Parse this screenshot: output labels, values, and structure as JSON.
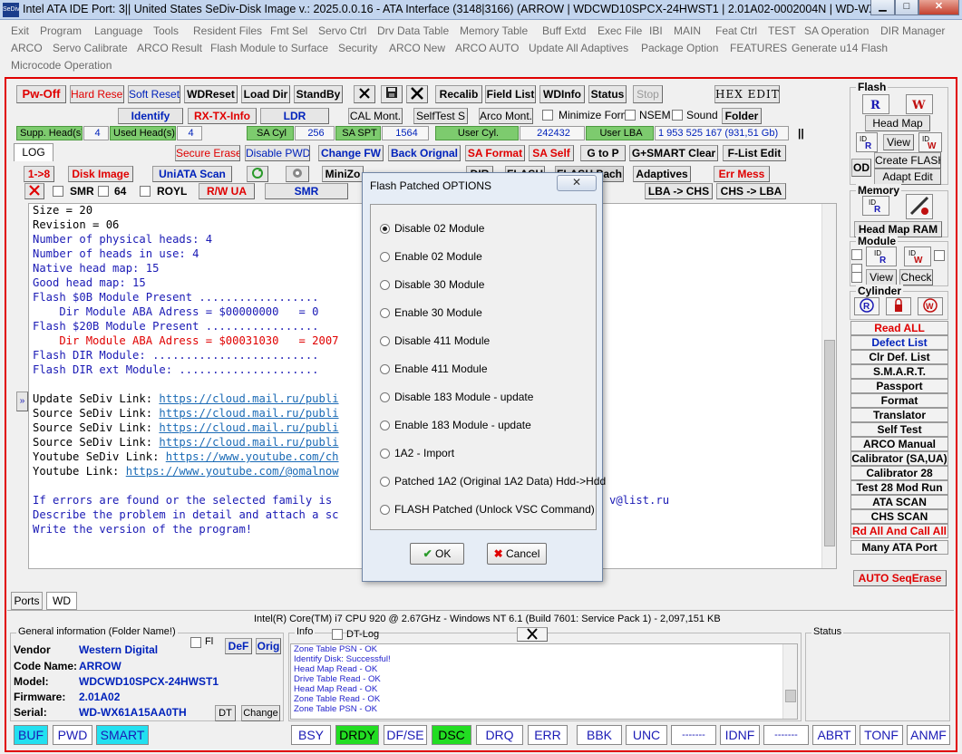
{
  "window": {
    "icon": "SeDiv",
    "title": "Intel ATA IDE  Port: 3|| United States  SeDiv-Disk Image v.: 2025.0.0.16 - ATA Interface (3148|3166)  (ARROW | WDCWD10SPCX-24HWST1 | 2.01A02-0002004N | WD-WX61A1...",
    "min": "▁",
    "max": "□",
    "close": "✕"
  },
  "menu": [
    "Exit",
    "Program",
    "Language",
    "Tools",
    "Resident Files",
    "Fmt Sel",
    "Servo Ctrl",
    "Drv Data Table",
    "Memory Table",
    "Buff Extd",
    "Exec File",
    "IBI",
    "MAIN",
    "Feat Ctrl",
    "TEST",
    "SA Operation",
    "DIR Manager",
    "ARCO",
    "Servo Calibrate",
    "ARCO Result",
    "Flash Module to Surface",
    "Security",
    "ARCO New",
    "ARCO AUTO",
    "Update All Adaptives",
    "Package Option",
    "FEATURES",
    "Generate u14 Flash",
    "Microcode Operation"
  ],
  "toolbar": {
    "pw_off": "Pw-Off",
    "hard_reset": "Hard Reset",
    "soft_reset": "Soft Reset",
    "wdreset": "WDReset",
    "load_dir": "Load Dir",
    "standby": "StandBy",
    "recalib": "Recalib",
    "field_list": "Field List",
    "wdinfo": "WDInfo",
    "status": "Status",
    "stop": "Stop",
    "hex_edit": "HEX EDIT",
    "identify": "Identify",
    "rx_tx": "RX-TX-Info",
    "ldr": "LDR",
    "cal_mont": "CAL Mont.",
    "selftest": "SelfTest S",
    "arco_mont": "Arco Mont.",
    "minimize_form": "Minimize Form",
    "nsem": "NSEM",
    "sound": "Sound",
    "folder": "Folder",
    "supp_heads_label": "Supp. Head(s)",
    "supp_heads": "4",
    "used_heads_label": "Used Head(s)",
    "used_heads": "4",
    "sa_cyl_label": "SA Cyl",
    "sa_cyl": "256",
    "sa_spt_label": "SA SPT",
    "sa_spt": "1564",
    "user_cyl_label": "User Cyl.",
    "user_cyl": "242432",
    "user_lba_label": "User LBA",
    "user_lba": "1 953 525 167  (931,51 Gb)",
    "pause": "||",
    "log_tab": "LOG",
    "secure_erase": "Secure Erase",
    "disable_pwd": "Disable PWD",
    "change_fw": "Change FW",
    "back_original": "Back Orignal",
    "sa_format": "SA Format",
    "sa_self": "SA Self",
    "g_to_p": "G to P",
    "gsmart_clear": "G+SMART Clear",
    "flist_edit": "F-List Edit",
    "one_to_eight": "1->8",
    "disk_image": "Disk Image",
    "uniata_scan": "UniATA Scan",
    "minizone": "MiniZo",
    "dir": "DIR",
    "flash": "FLASH",
    "flash_pach": "FLASH Pach",
    "adaptives": "Adaptives",
    "err_mess": "Err Mess",
    "smr": "SMR",
    "sixty_four": "64",
    "royl": "ROYL",
    "rw_ua": "R/W UA",
    "smr_btn": "SMR",
    "lba_chs": "LBA -> CHS",
    "chs_lba": "CHS -> LBA"
  },
  "console": {
    "lines": [
      {
        "t": "Size = 20",
        "c": "k"
      },
      {
        "t": "Revision = 06",
        "c": "k"
      },
      {
        "t": "Number of physical heads: 4",
        "c": "b"
      },
      {
        "t": "Number of heads in use: 4",
        "c": "b"
      },
      {
        "t": "Native head map: 15",
        "c": "b"
      },
      {
        "t": "Good head map: 15",
        "c": "b"
      },
      {
        "t": "Flash $0B Module Present ..................",
        "c": "b"
      },
      {
        "t": "    Dir Module ABA Adress = $00000000   = 0",
        "c": "b"
      },
      {
        "t": "Flash $20B Module Present .................",
        "c": "b"
      },
      {
        "t": "    Dir Module ABA Adress = $00031030   = 2007",
        "c": "r"
      },
      {
        "t": "Flash DIR Module: .........................",
        "c": "b"
      },
      {
        "t": "Flash DIR ext Module: .....................",
        "c": "b"
      }
    ],
    "links": [
      {
        "label": "Update SeDiv Link: ",
        "url": "https://cloud.mail.ru/publi"
      },
      {
        "label": "Source SeDiv Link: ",
        "url": "https://cloud.mail.ru/publi"
      },
      {
        "label": "Source SeDiv Link: ",
        "url": "https://cloud.mail.ru/publi"
      },
      {
        "label": "Source SeDiv Link: ",
        "url": "https://cloud.mail.ru/publi"
      },
      {
        "label": "Youtube SeDiv Link: ",
        "url": "https://www.youtube.com/ch"
      },
      {
        "label": "Youtube Link: ",
        "url": "https://www.youtube.com/@omalnow"
      }
    ],
    "footer": [
      "If errors are found or the selected family is",
      "Describe the problem in detail and attach a sc",
      "Write the version of the program!"
    ],
    "email_tail": "v@list.ru",
    "expand": "»"
  },
  "dialog": {
    "title": "Flash Patched OPTIONS",
    "close": "✕",
    "options": [
      "Disable 02 Module",
      "Enable 02 Module",
      "Disable 30 Module",
      "Enable 30 Module",
      "Disable 411 Module",
      "Enable 411 Module",
      "Disable 183 Module - update",
      "Enable 183 Module - update",
      "1A2 - Import",
      "Patched 1A2 (Original 1A2 Data)  Hdd->Hdd",
      "FLASH Patched (Unlock VSC Command)"
    ],
    "selected": 0,
    "ok": "OK",
    "cancel": "Cancel"
  },
  "right": {
    "flash_title": "Flash",
    "head_map": "Head Map",
    "view": "View",
    "od": "OD",
    "create_flash": "Create FLASH",
    "adapt_edit": "Adapt Edit",
    "memory_title": "Memory",
    "head_map_ram": "Head Map RAM",
    "module_title": "Module",
    "view2": "View",
    "check": "Check",
    "cylinder_title": "Cylinder",
    "buttons": [
      {
        "t": "Read ALL",
        "c": "red"
      },
      {
        "t": "Defect List",
        "c": "blue"
      },
      {
        "t": "Clr Def. List",
        "c": ""
      },
      {
        "t": "S.M.A.R.T.",
        "c": ""
      },
      {
        "t": "Passport",
        "c": ""
      },
      {
        "t": "Format",
        "c": ""
      },
      {
        "t": "Translator",
        "c": ""
      },
      {
        "t": "Self Test",
        "c": ""
      },
      {
        "t": "ARCO Manual",
        "c": ""
      },
      {
        "t": "Calibrator (SA,UA)",
        "c": ""
      },
      {
        "t": "Calibrator 28",
        "c": ""
      },
      {
        "t": "Test 28 Mod Run",
        "c": ""
      },
      {
        "t": "ATA SCAN",
        "c": ""
      },
      {
        "t": "CHS SCAN",
        "c": ""
      },
      {
        "t": "Rd All And Call All",
        "c": "red"
      },
      {
        "t": "Many ATA Port",
        "c": ""
      }
    ],
    "auto_seq": "AUTO SeqErase"
  },
  "tabs": [
    "Ports",
    "WD"
  ],
  "cpu_info": "Intel(R) Core(TM) i7 CPU 920  @ 2.67GHz - Windows NT 6.1 (Build 7601: Service Pack 1) -  2,097,151 KB",
  "general": {
    "title": "General information (Folder Name!)",
    "fl": "Fl",
    "def": "DeF",
    "orig": "Orig",
    "vendor_label": "Vendor",
    "vendor": "Western Digital",
    "code_label": "Code Name:",
    "code": "ARROW",
    "model_label": "Model:",
    "model": "WDCWD10SPCX-24HWST1",
    "fw_label": "Firmware:",
    "fw": "2.01A02",
    "serial_label": "Serial:",
    "serial": "WD-WX61A15AA0TH",
    "dt": "DT",
    "change": "Change"
  },
  "info": {
    "title": "Info",
    "dtlog": "DT-Log",
    "log": [
      "Zone Table PSN - OK",
      "Identify Disk: Successful!",
      "Head Map Read - OK",
      "Drive Table Read - OK",
      "Head Map Read - OK",
      "Zone Table Read - OK",
      "Zone Table PSN - OK"
    ]
  },
  "status_title": "Status",
  "statusbar": [
    "BUF",
    "PWD",
    "SMART",
    "BSY",
    "DRDY",
    "DF/SE",
    "DSC",
    "DRQ",
    "ERR",
    "BBK",
    "UNC",
    "-------",
    "IDNF",
    "-------",
    "ABRT",
    "TONF",
    "ANMF"
  ]
}
